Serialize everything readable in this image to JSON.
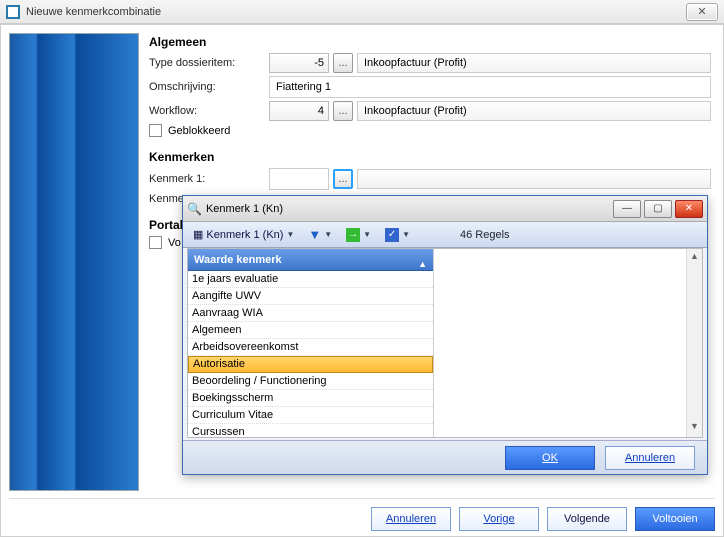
{
  "window": {
    "title": "Nieuwe kenmerkcombinatie",
    "close_glyph": "✕"
  },
  "sections": {
    "algemeen_title": "Algemeen",
    "kenmerken_title": "Kenmerken",
    "portal_title": "Portal"
  },
  "algemeen": {
    "type_label": "Type dossieritem:",
    "type_value": "-5",
    "type_desc": "Inkoopfactuur (Profit)",
    "omschrijving_label": "Omschrijving:",
    "omschrijving_value": "Fiattering 1",
    "workflow_label": "Workflow:",
    "workflow_value": "4",
    "workflow_desc": "Inkoopfactuur (Profit)",
    "geblokkeerd_label": "Geblokkeerd"
  },
  "kenmerken": {
    "k1_label": "Kenmerk 1:",
    "k1_value": "",
    "k2_label": "Kenme",
    "browse_glyph": "..."
  },
  "portal": {
    "vo_label": "Vo"
  },
  "popup": {
    "title": "Kenmerk 1 (Kn)",
    "min_glyph": "—",
    "max_glyph": "▢",
    "close_glyph": "✕",
    "toolbar": {
      "view_label": "Kenmerk 1 (Kn)",
      "regels": "46 Regels"
    },
    "column_header": "Waarde kenmerk",
    "items": [
      "1e jaars evaluatie",
      "Aangifte UWV",
      "Aanvraag WIA",
      "Algemeen",
      "Arbeidsovereenkomst",
      "Autorisatie",
      "Beoordeling / Functionering",
      "Boekingsscherm",
      "Curriculum Vitae",
      "Cursussen"
    ],
    "selected_index": 5,
    "footer": {
      "ok": "OK",
      "cancel": "Annuleren"
    }
  },
  "wizard": {
    "annuleren": "Annuleren",
    "vorige": "Vorige",
    "volgende": "Volgende",
    "voltooien": "Voltooien"
  }
}
